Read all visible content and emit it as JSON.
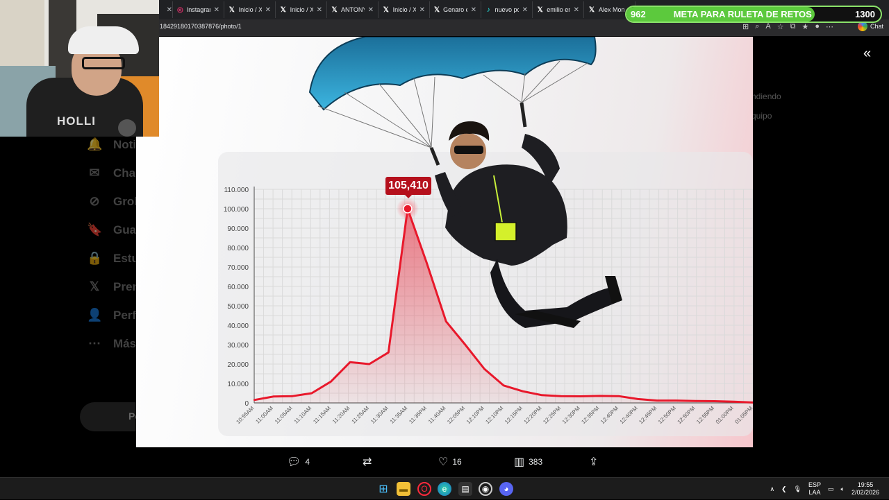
{
  "browser": {
    "tabs": [
      {
        "label": "Instagram",
        "icon": "instagram-icon",
        "glyph": "◎"
      },
      {
        "label": "Inicio / X",
        "icon": "x-icon",
        "glyph": "𝕏"
      },
      {
        "label": "Inicio / X",
        "icon": "x-icon",
        "glyph": "𝕏"
      },
      {
        "label": "ANTONY",
        "icon": "x-icon",
        "glyph": "𝕏"
      },
      {
        "label": "Inicio / X",
        "icon": "x-icon",
        "glyph": "𝕏"
      },
      {
        "label": "Genaro en",
        "icon": "x-icon",
        "glyph": "𝕏"
      },
      {
        "label": "nuevo por",
        "icon": "tiktok-icon",
        "glyph": "♪"
      },
      {
        "label": "emilio en",
        "icon": "x-icon",
        "glyph": "𝕏"
      },
      {
        "label": "Alex Mon",
        "icon": "x-icon",
        "glyph": "𝕏"
      }
    ],
    "url": "18429180170387876/photo/1",
    "chat_label": "Chat"
  },
  "goal_bar": {
    "current": "962",
    "title": "META PARA RULETA DE RETOS",
    "target": "1300",
    "progress": 0.74,
    "color": "#5cc93d"
  },
  "webcam": {
    "shirt_text": "HOLLI"
  },
  "photo": {
    "callout": "105,410"
  },
  "chart_data": {
    "type": "area",
    "color": "#e8182b",
    "y_ticks": [
      "110.000",
      "100.000",
      "90.000",
      "80.000",
      "70.000",
      "60.000",
      "50.000",
      "40.000",
      "30.000",
      "20.000",
      "10.000",
      "0"
    ],
    "ylim": [
      0,
      110000
    ],
    "x": [
      "10:55AM",
      "11:00AM",
      "11:05AM",
      "11:10AM",
      "11:15AM",
      "11:20AM",
      "11:25AM",
      "11:30AM",
      "11:35AM",
      "11:35PM",
      "11:40AM",
      "12:05PM",
      "12:10PM",
      "12:10PM",
      "12:15PM",
      "12:20PM",
      "12:25PM",
      "12:30PM",
      "12:35PM",
      "12:40PM",
      "12:40PM",
      "12:45PM",
      "12:50PM",
      "12:50PM",
      "12:55PM",
      "01:00PM",
      "01:05PM"
    ],
    "values": [
      1500,
      3300,
      3500,
      5000,
      11000,
      21000,
      20000,
      26000,
      100000,
      72000,
      42000,
      30000,
      17500,
      9000,
      6000,
      4000,
      3500,
      3400,
      3600,
      3500,
      2000,
      1200,
      1200,
      1000,
      900,
      600,
      200
    ],
    "peak_label": "105,410",
    "grid": true
  },
  "actions": {
    "replies": "4",
    "likes": "16",
    "views": "383"
  },
  "sidebar_ghost": [
    {
      "label": "Notificaciones",
      "icon": "bell-icon",
      "glyph": "🔔"
    },
    {
      "label": "Chat",
      "icon": "mail-icon",
      "glyph": "✉"
    },
    {
      "label": "Grok",
      "icon": "grok-icon",
      "glyph": "⊘"
    },
    {
      "label": "Guardados",
      "icon": "bookmark-icon",
      "glyph": "🔖"
    },
    {
      "label": "Estudio",
      "icon": "lock-icon",
      "glyph": "🔒"
    },
    {
      "label": "Premium",
      "icon": "x-icon",
      "glyph": "𝕏"
    },
    {
      "label": "Perfil",
      "icon": "user-icon",
      "glyph": "👤"
    },
    {
      "label": "Más opciones",
      "icon": "more-icon",
      "glyph": "⋯"
    }
  ],
  "post_button": "Postear",
  "right_ghost": [
    "ndiendo",
    "quipo"
  ],
  "taskbar": {
    "lang_top": "ESP",
    "lang_bottom": "LAA",
    "time": "19:55",
    "date": "2/02/2026"
  }
}
